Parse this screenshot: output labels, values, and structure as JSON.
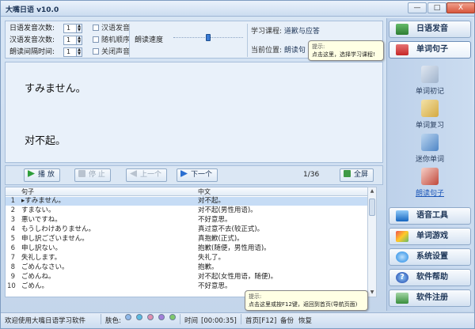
{
  "window": {
    "title": "大嘴日语 v10.0",
    "buttons": [
      "—",
      "□",
      "X"
    ]
  },
  "settings": {
    "rows": [
      {
        "label": "日语发音次数:",
        "value": "1"
      },
      {
        "label": "汉语发音次数:",
        "value": "1"
      },
      {
        "label": "朗读间隔时间:",
        "value": "1"
      }
    ],
    "checks": [
      "汉语发音",
      "随机顺序",
      "关闭声音"
    ],
    "speed_label": "朗读速度",
    "speed_level": 0.5,
    "course_label": "学习课程:",
    "course_value": "道歉与应答",
    "position_label": "当前位置:",
    "position_value": "朗读句"
  },
  "tooltip_course": {
    "title": "提示:",
    "text": "点击这里，选择学习课程!"
  },
  "display": {
    "japanese": "すみません。",
    "chinese": "对不起。"
  },
  "controls": {
    "play": "播 放",
    "stop": "停 止",
    "prev": "上一个",
    "next": "下一个",
    "counter": "1/36",
    "fullscreen": "全屏"
  },
  "table": {
    "headers": {
      "sentence": "句子",
      "chinese": "中文"
    },
    "rows": [
      {
        "no": "1",
        "jp": "▸すみません。",
        "cn": "对不起。"
      },
      {
        "no": "2",
        "jp": "すまない。",
        "cn": "对不起(男性用语)。"
      },
      {
        "no": "3",
        "jp": "悪いですね。",
        "cn": "不好意思。"
      },
      {
        "no": "4",
        "jp": "もうしわけありません。",
        "cn": "真过意不去(较正式)。"
      },
      {
        "no": "5",
        "jp": "申し訳ございません。",
        "cn": "真抱歉(正式)。"
      },
      {
        "no": "6",
        "jp": "申し訳ない。",
        "cn": "抱歉(随便，男性用语)。"
      },
      {
        "no": "7",
        "jp": "失礼します。",
        "cn": "失礼了。"
      },
      {
        "no": "8",
        "jp": "ごめんなさい。",
        "cn": "抱歉。"
      },
      {
        "no": "9",
        "jp": "ごめんね。",
        "cn": "对不起(女性用语，随便)。"
      },
      {
        "no": "10",
        "jp": "ごめん。",
        "cn": "不好意思。"
      }
    ]
  },
  "tooltip_home": {
    "title": "提示:",
    "text": "点击这里或按F12键，返回到首页(导航页面)"
  },
  "sidebar": {
    "top": [
      {
        "label": "日语发音"
      },
      {
        "label": "单词句子"
      }
    ],
    "subs": [
      {
        "label": "单词初记"
      },
      {
        "label": "单词复习"
      },
      {
        "label": "迷你单词"
      },
      {
        "label": "朗读句子"
      }
    ],
    "bottom": [
      {
        "label": "语音工具"
      },
      {
        "label": "单词游戏"
      },
      {
        "label": "系统设置"
      },
      {
        "label": "软件帮助"
      },
      {
        "label": "软件注册"
      }
    ]
  },
  "status": {
    "welcome": "欢迎使用大嘴日语学习软件",
    "skin_label": "肤色:",
    "skin_colors": [
      "#8fb8e8",
      "#5bbbe0",
      "#e08fb0",
      "#a27fd9",
      "#7fc96b"
    ],
    "time_label": "时间",
    "time_value": "[00:00:35]",
    "home": "首页[F12]",
    "backup": "备份",
    "restore": "恢复"
  },
  "colors": {
    "accent": "#1d3557",
    "selection": "#c6dcf5"
  }
}
